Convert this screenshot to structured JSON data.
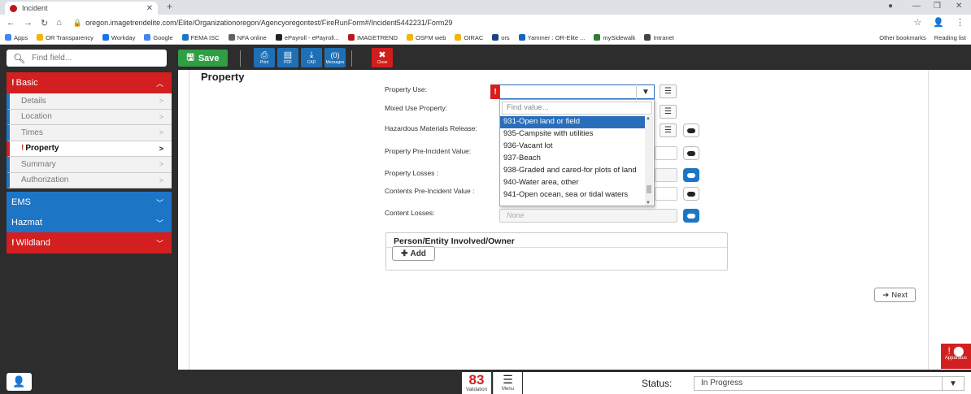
{
  "browser": {
    "tab_title": "Incident",
    "url": "oregon.imagetrendelite.com/Elite/Organizationoregon/Agencyoregontest/FireRunForm#/Incident5442231/Form29",
    "bookmarks": [
      "Apps",
      "OR Transparency",
      "Workday",
      "Google",
      "FEMA ISC",
      "NFA online",
      "ePayroll - ePayroll...",
      "IMAGETREND",
      "OSFM web",
      "OIRAC",
      "ors",
      "Yammer : OR-Elite ...",
      "mySidewalk",
      "Intranet"
    ],
    "bookmarks_right": [
      "Other bookmarks",
      "Reading list"
    ]
  },
  "toolbar": {
    "find_placeholder": "Find field...",
    "save_label": "Save",
    "print_label": "Print",
    "pdf_label": "PDF",
    "cad_label": "CAD",
    "messages_count": "(0)",
    "messages_label": "Messages",
    "close_label": "Close"
  },
  "nav": {
    "basic": "Basic",
    "items": [
      "Details",
      "Location",
      "Times",
      "Property",
      "Summary",
      "Authorization"
    ],
    "active": "Property",
    "ems": "EMS",
    "hazmat": "Hazmat",
    "wildland": "Wildland"
  },
  "form": {
    "section_title": "Property",
    "fields": {
      "property_use": "Property Use:",
      "mixed_use": "Mixed Use Property:",
      "hazmat_release": "Hazardous Materials Release:",
      "pre_incident_value": "Property Pre-Incident Value:",
      "property_losses": "Property Losses :",
      "contents_pre_value": "Contents Pre-Incident Value :",
      "content_losses": "Content Losses:"
    },
    "none_placeholder": "None",
    "dropdown": {
      "find_placeholder": "Find value...",
      "options": [
        "931-Open land or field",
        "935-Campsite with utilities",
        "936-Vacant lot",
        "937-Beach",
        "938-Graded and cared-for plots of land",
        "940-Water area, other",
        "941-Open ocean, sea or tidal waters"
      ],
      "selected_index": 0
    },
    "person_box_title": "Person/Entity Involved/Owner",
    "add_label": "Add",
    "next_label": "Next"
  },
  "side_tab": {
    "label": "Apparatus"
  },
  "footer": {
    "validation_count": "83",
    "validation_label": "Validation",
    "menu_label": "Menu",
    "status_label": "Status:",
    "status_value": "In Progress"
  },
  "colors": {
    "brand_red": "#d31f1f",
    "brand_blue": "#1d75c6",
    "save_green": "#2f9e44",
    "dark_bg": "#2d2d2d"
  }
}
